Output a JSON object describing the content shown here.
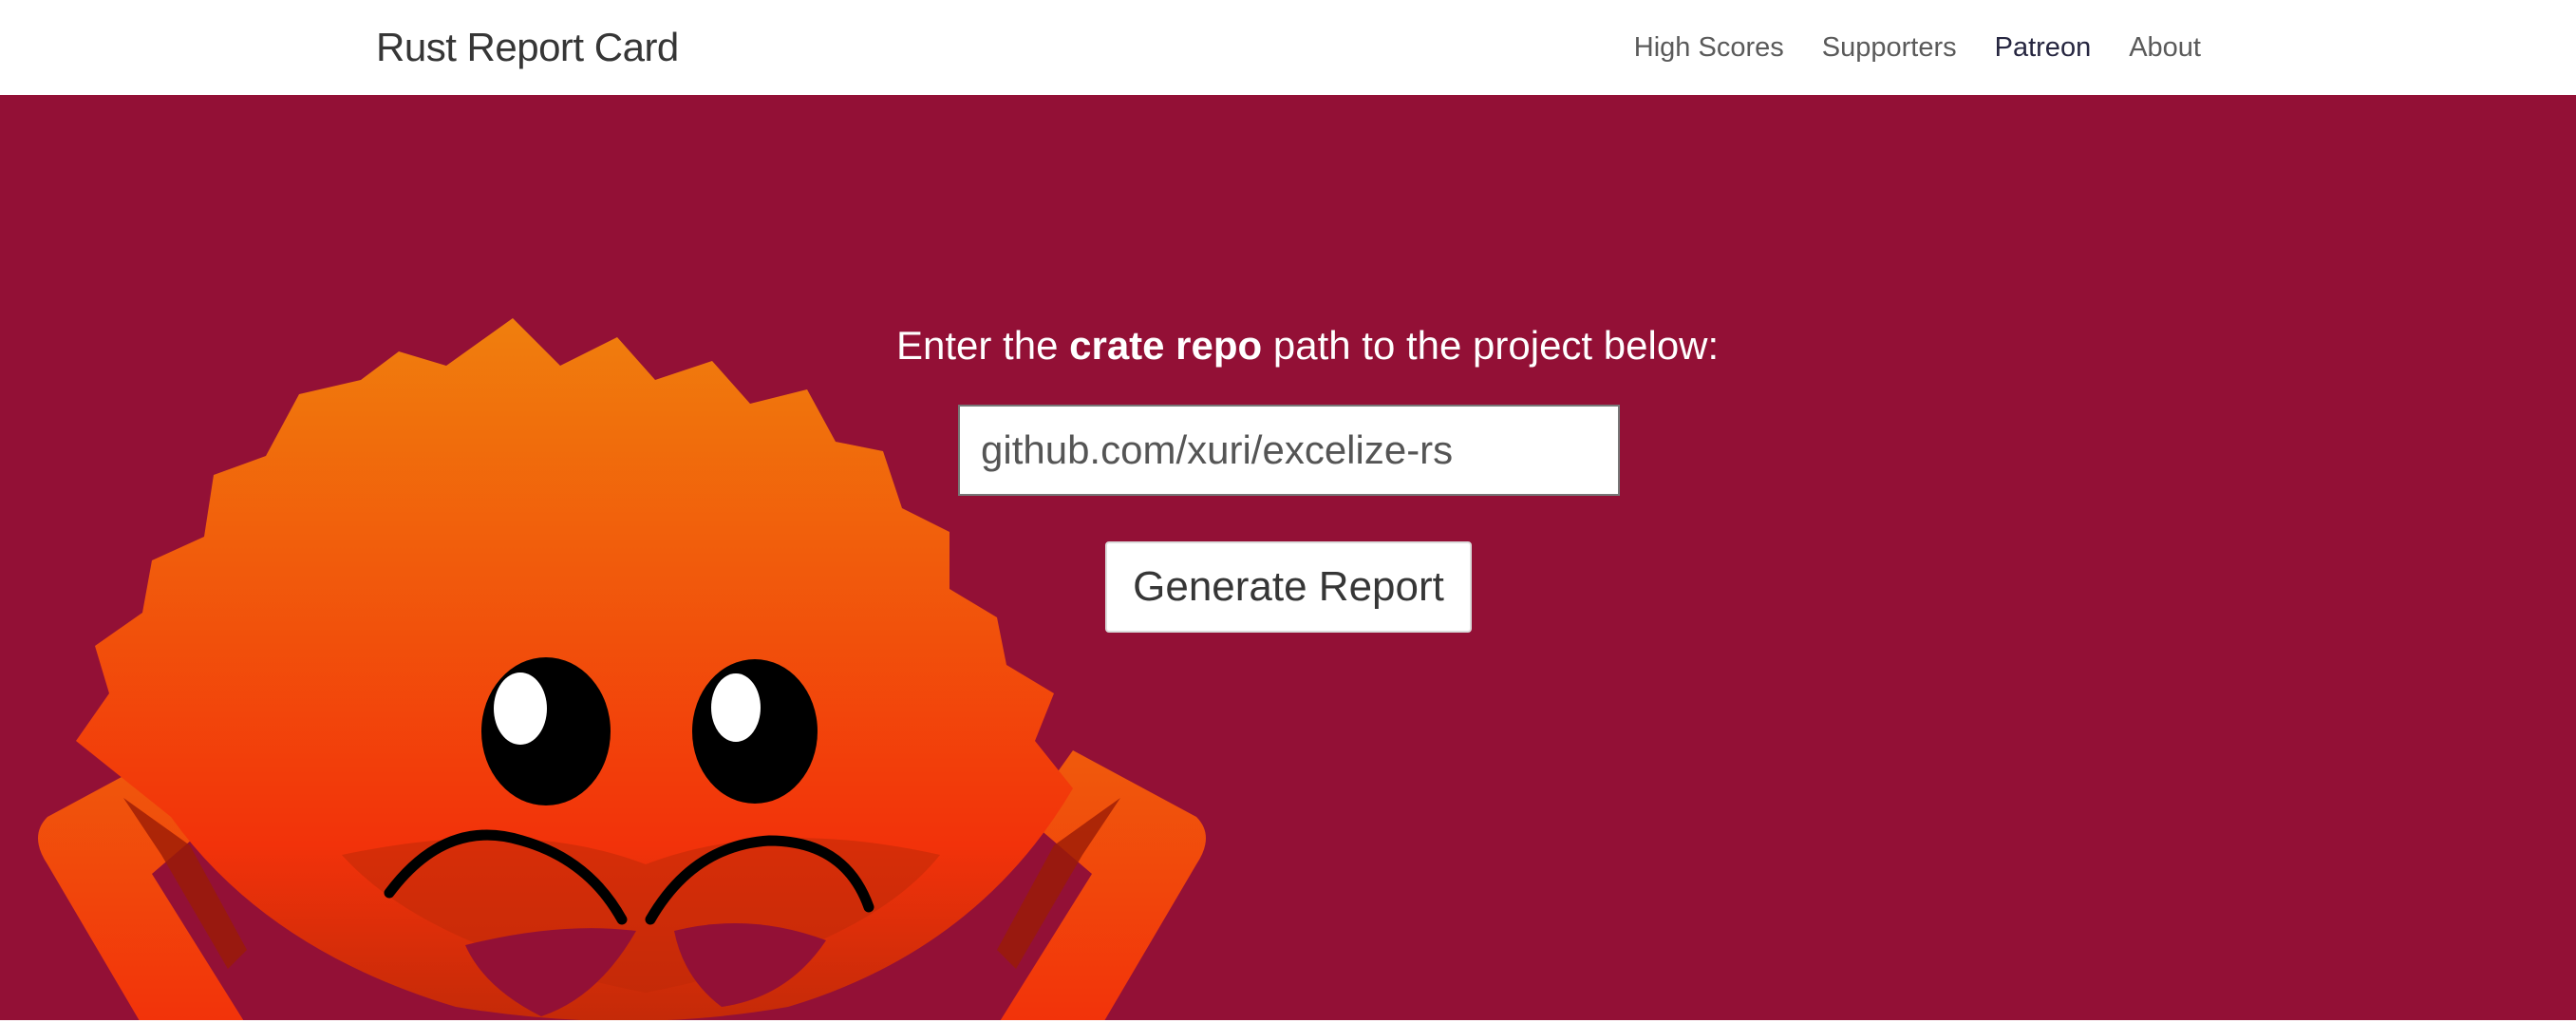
{
  "header": {
    "brand": "Rust Report Card",
    "nav": [
      {
        "label": "High Scores"
      },
      {
        "label": "Supporters"
      },
      {
        "label": "Patreon"
      },
      {
        "label": "About"
      }
    ]
  },
  "hero": {
    "prompt_prefix": "Enter the ",
    "prompt_bold": "crate repo",
    "prompt_suffix": " path to the project below:",
    "input_value": "github.com/xuri/excelize-rs",
    "button_label": "Generate Report",
    "mascot_icon": "ferris-crab-icon",
    "background_color": "#931036",
    "mascot_color_top": "#f07f0d",
    "mascot_color_bottom": "#f2320a"
  }
}
